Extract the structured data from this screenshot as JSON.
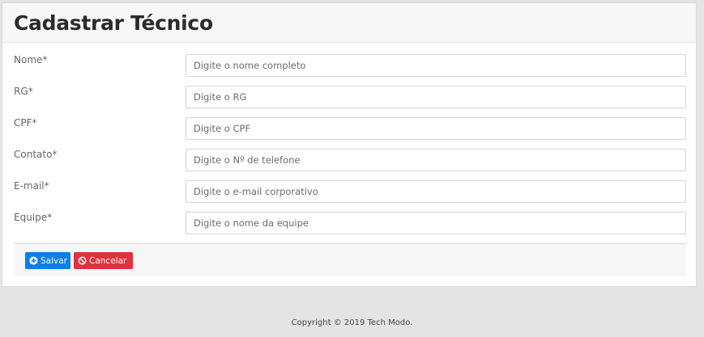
{
  "header": {
    "title": "Cadastrar Técnico"
  },
  "form": {
    "fields": [
      {
        "label": "Nome*",
        "placeholder": "Digite o nome completo",
        "value": ""
      },
      {
        "label": "RG*",
        "placeholder": "Digite o RG",
        "value": ""
      },
      {
        "label": "CPF*",
        "placeholder": "Digite o CPF",
        "value": ""
      },
      {
        "label": "Contato*",
        "placeholder": "Digite o Nº de telefone",
        "value": ""
      },
      {
        "label": "E-mail*",
        "placeholder": "Digite o e-mail corporativo",
        "value": ""
      },
      {
        "label": "Equipe*",
        "placeholder": "Digite o nome da equipe",
        "value": ""
      }
    ]
  },
  "actions": {
    "save_label": "Salvar",
    "save_icon": "plus-circle-icon",
    "save_color": "#0d7ee8",
    "cancel_label": "Cancelar",
    "cancel_icon": "ban-icon",
    "cancel_color": "#e0323f"
  },
  "footer": {
    "copyright": "Copyright © 2019 Tech Modo."
  }
}
